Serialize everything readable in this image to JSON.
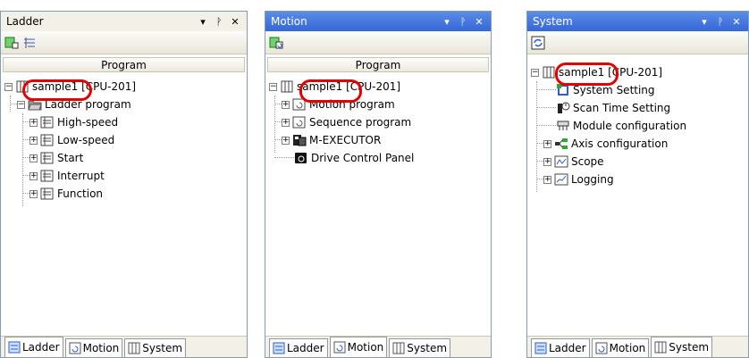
{
  "panels": [
    {
      "title": "Ladder",
      "column_header": "Program",
      "root": {
        "name": "sample1",
        "suffix": "[CPU-201]"
      },
      "items": [
        {
          "label": "Ladder program"
        },
        {
          "label": "High-speed"
        },
        {
          "label": "Low-speed"
        },
        {
          "label": "Start"
        },
        {
          "label": "Interrupt"
        },
        {
          "label": "Function"
        }
      ]
    },
    {
      "title": "Motion",
      "column_header": "Program",
      "root": {
        "name": "sample1",
        "suffix": "[CPU-201]"
      },
      "items": [
        {
          "label": "Motion program"
        },
        {
          "label": "Sequence program"
        },
        {
          "label": "M-EXECUTOR"
        },
        {
          "label": "Drive Control Panel"
        }
      ]
    },
    {
      "title": "System",
      "root": {
        "name": "sample1",
        "suffix": "[CPU-201]"
      },
      "items": [
        {
          "label": "System Setting"
        },
        {
          "label": "Scan Time Setting"
        },
        {
          "label": "Module configuration"
        },
        {
          "label": "Axis configuration"
        },
        {
          "label": "Scope"
        },
        {
          "label": "Logging"
        }
      ]
    }
  ],
  "tabs": {
    "ladder": "Ladder",
    "motion": "Motion",
    "system": "System"
  },
  "titlebar_buttons": {
    "dropdown": "▾",
    "pin": "ᚹ",
    "close": "✕"
  },
  "colors": {
    "highlight": "#e60000",
    "active_title": "#3567d8",
    "panel_bg": "#f3f1e7"
  }
}
